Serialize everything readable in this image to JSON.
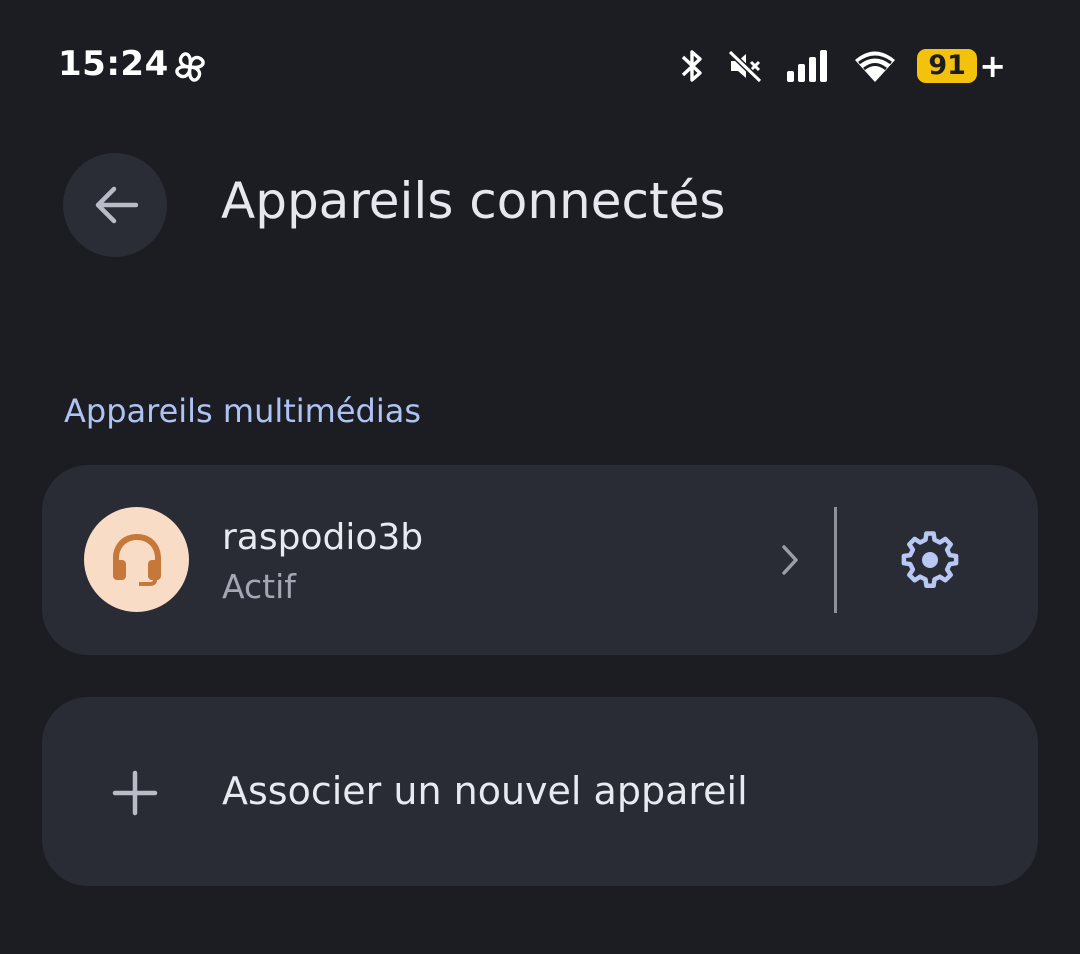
{
  "status_bar": {
    "time": "15:24",
    "battery_level": "91",
    "battery_charging": "+",
    "icons": [
      "pinwheel-icon",
      "bluetooth-icon",
      "mute-icon",
      "signal-icon",
      "wifi-icon",
      "battery-icon"
    ]
  },
  "app_bar": {
    "title": "Appareils connectés",
    "back_icon": "arrow-back-icon"
  },
  "section": {
    "header": "Appareils multimédias"
  },
  "device": {
    "name": "raspodio3b",
    "status": "Actif",
    "icon": "headset-icon",
    "avatar_color": "#f9dcc6",
    "icon_color": "#c6773a"
  },
  "pair_new": {
    "label": "Associer un nouvel appareil",
    "icon": "plus-icon"
  },
  "colors": {
    "background": "#1b1d22",
    "card": "#292c35",
    "accent": "#aec3f3",
    "battery": "#f4c20d"
  }
}
